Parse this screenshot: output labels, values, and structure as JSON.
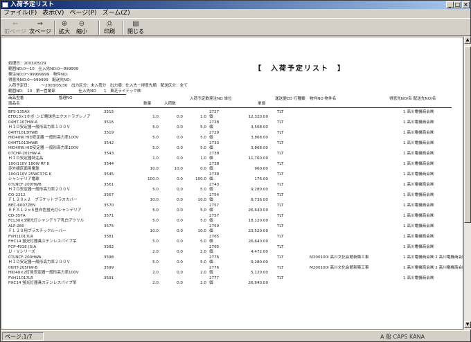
{
  "window": {
    "title": "入荷予定リスト"
  },
  "menu": [
    "ファイル(F)",
    "表示(V)",
    "ページ(P)",
    "ズーム(Z)"
  ],
  "toolbar": [
    {
      "label": "前ページ",
      "icon": "prev-page-icon",
      "enabled": false
    },
    {
      "label": "次ページ",
      "icon": "next-page-icon",
      "enabled": true
    },
    {
      "label": "拡大",
      "icon": "zoom-in-icon",
      "enabled": true
    },
    {
      "label": "縮小",
      "icon": "zoom-out-icon",
      "enabled": true
    },
    {
      "label": "印刷",
      "icon": "printer-icon",
      "enabled": true
    },
    {
      "label": "閉じる",
      "icon": "close-door-icon",
      "enabled": true
    }
  ],
  "report": {
    "title": "【　入荷予定リスト　】",
    "header": [
      "処理日：2003/05/29",
      "範囲NO:0～10　仕入先NO:0～999999",
      "発注NO:0～99999999　物件NO:",
      "得意先NO:0～999999　配送先NO:",
      "入荷予定日：　　　～2003/05/30　出力区分：未入荷分　出力順：仕入先－得意先順　配送区分：全て",
      "範囲NO:　10　第一営業部　　　　　　仕入先NO　　1　東芝ライテック㈱",
      "商品型番　　　　　　　　　管理NO",
      "商品名"
    ],
    "columns": [
      "数量",
      "入荷数",
      "入荷予定数",
      "発注NO 単位",
      "単価",
      "運送便CD 行種類",
      "物件NO 物件名",
      "得意先NO/名 配送先NO/名"
    ],
    "rows": [
      {
        "model": "BFS-135AX",
        "name": "EFD13×1ホボ⁻ンビ電球色エクストラブレノア",
        "mgmt": "3515",
        "qty": "1.0",
        "recv": "0.0",
        "plan": "1.0",
        "po": "2727",
        "unit": "個",
        "price": "12,320.00",
        "ship": "TLT",
        "job": "",
        "cust": "1 高川電機商会㈱"
      },
      {
        "model": "04HT-107HW-A",
        "name": "ＨＩＤ安定器一般形高力率１００Ｖ",
        "mgmt": "3516",
        "qty": "5.0",
        "recv": "0.0",
        "plan": "5.0",
        "po": "2728",
        "unit": "個",
        "price": "3,568.00",
        "ship": "TLT",
        "job": "",
        "cust": "1 高川電機商会㈱"
      },
      {
        "model": "04HT1013HWB",
        "name": "HID40W HID安定器 一般形高力率100V",
        "mgmt": "3519",
        "qty": "5.0",
        "recv": "0.0",
        "plan": "5.0",
        "po": "2729",
        "unit": "個",
        "price": "3,868.00",
        "ship": "TLT",
        "job": "",
        "cust": "1 高川電機商会㈱"
      },
      {
        "model": "04HT1013HWB",
        "name": "HID40W HID安定器 一般形高力率100V",
        "mgmt": "3542",
        "qty": "5.0",
        "recv": "0.0",
        "plan": "5.0",
        "po": "2733",
        "unit": "個",
        "price": "3,868.00",
        "ship": "TLT",
        "job": "",
        "cust": "1 高川電機商会㈱"
      },
      {
        "model": "07CHP-201HW-A",
        "name": "ＨＩＤ安定器特注品",
        "mgmt": "3543",
        "qty": "1.0",
        "recv": "0.0",
        "plan": "1.0",
        "po": "2738",
        "unit": "個",
        "price": "11,760.00",
        "ship": "TLT",
        "job": "",
        "cust": "1 高川電機商会㈱"
      },
      {
        "model": "100/110V 180W RF K",
        "name": "赤外線床面用電球",
        "mgmt": "3544",
        "qty": "10.0",
        "recv": "10.0",
        "plan": "0.0",
        "po": "2738",
        "unit": "個",
        "price": "960.00",
        "ship": "TLT",
        "job": "",
        "cust": "1 高川電機商会㈱"
      },
      {
        "model": "100/110V 25WC37G K",
        "name": "シャンデリア電球",
        "mgmt": "3545",
        "qty": "100.0",
        "recv": "0.0",
        "plan": "100.0",
        "po": "2738",
        "unit": "個",
        "price": "176.00",
        "ship": "TLT",
        "job": "",
        "cust": "1 高川電機商会㈱"
      },
      {
        "model": "07LNCF-200HWB",
        "name": "ＨＩＤ安定器一般形高力率２００Ｖ",
        "mgmt": "3561",
        "qty": "5.0",
        "recv": "0.0",
        "plan": "5.0",
        "po": "2743",
        "unit": "個",
        "price": "9,280.00",
        "ship": "TLT",
        "job": "",
        "cust": "1 高川電機商会㈱"
      },
      {
        "model": "CO-2212",
        "name": "ＦＬ２０×２　ブラケットブラスカバー",
        "mgmt": "3567",
        "qty": "10.0",
        "recv": "0.0",
        "plan": "10.0",
        "po": "2754",
        "unit": "個",
        "price": "8,736.00",
        "ship": "TLT",
        "job": "",
        "cust": "1 高川電機商会㈱"
      },
      {
        "model": "BEC-6007ZEN",
        "name": "ＥＦＡ１２×６昼白色蛍光灯シャンデリア",
        "mgmt": "3570",
        "qty": "5.0",
        "recv": "0.0",
        "plan": "5.0",
        "po": "2757",
        "unit": "個",
        "price": "26,640.00",
        "ship": "TLT",
        "job": "",
        "cust": "1 高川電機商会㈱"
      },
      {
        "model": "CD-357A",
        "name": "FCL30×3蛍光灯シャンデリア乳白アクリル",
        "mgmt": "3571",
        "qty": "5.0",
        "recv": "0.0",
        "plan": "5.0",
        "po": "2757",
        "unit": "個",
        "price": "18,120.00",
        "ship": "TLT",
        "job": "",
        "cust": "1 高川電機商会㈱"
      },
      {
        "model": "ALP-280",
        "name": "ＦＬ２０用プラスチックルーバー",
        "mgmt": "3575",
        "qty": "10.0",
        "recv": "0.0",
        "plan": "10.0",
        "po": "2759",
        "unit": "個",
        "price": "23,520.00",
        "ship": "TLT",
        "job": "",
        "cust": "1 高川電機商会㈱"
      },
      {
        "model": "FVH11017LR",
        "name": "FHC14 蛍光灯器具ステンレスパイプ吊",
        "mgmt": "3581",
        "qty": "5.0",
        "recv": "0.0",
        "plan": "5.0",
        "po": "2765",
        "unit": "個",
        "price": "26,640.00",
        "ship": "TLT",
        "job": "",
        "cust": "1 高川電機商会㈱"
      },
      {
        "model": "FCP-4918 (S)A",
        "name": "Ｕ・Ｖシリーズ",
        "mgmt": "3582",
        "qty": "2.0",
        "recv": "0.0",
        "plan": "2.0",
        "po": "2765",
        "unit": "個",
        "price": "4,472.00",
        "ship": "TLT",
        "job": "",
        "cust": "1 高川電機商会㈱"
      },
      {
        "model": "07LNCF-200HWA",
        "name": "ＨＩＤ安定器一般形高力率２００Ｖ",
        "mgmt": "3598",
        "qty": "5.0",
        "recv": "0.0",
        "plan": "5.0",
        "po": "2776",
        "unit": "個",
        "price": "9,280.00",
        "ship": "TLT",
        "job": "M200100l 高川文化会館新築工事",
        "cust": "1 高川電機商会㈱ 2 高川電機商会㈱"
      },
      {
        "model": "06HT-205HW-B",
        "name": "HID40×2灯用安定器一般形高力率100V",
        "mgmt": "3599",
        "qty": "2.0",
        "recv": "0.0",
        "plan": "2.0",
        "po": "2776",
        "unit": "個",
        "price": "5,120.00",
        "ship": "TLT",
        "job": "M200100l 高川文化会館新築工事",
        "cust": "1 高川電機商会㈱ 2 高川電機商会㈱"
      },
      {
        "model": "FVH11017LR",
        "name": "FHC14 蛍光灯器具ステンレスパイプ吊",
        "mgmt": "3591",
        "qty": "2.0",
        "recv": "0.0",
        "plan": "2.0",
        "po": "2777",
        "unit": "個",
        "price": "26,640.00",
        "ship": "TLT",
        "job": "",
        "cust": "1 高川電機商会㈱"
      }
    ]
  },
  "status": {
    "page": "ページ:1/7",
    "tray": "A 般 CAPS KANA"
  }
}
